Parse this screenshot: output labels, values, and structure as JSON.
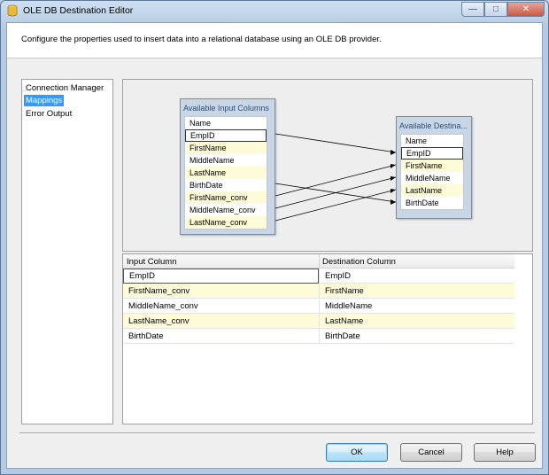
{
  "window": {
    "title": "OLE DB Destination Editor",
    "buttons": {
      "minimize_icon": "minimize-icon",
      "maximize_icon": "maximize-icon",
      "close_icon": "close-icon"
    }
  },
  "banner": {
    "description": "Configure the properties used to insert data into a relational database using an OLE DB provider."
  },
  "nav": {
    "items": [
      {
        "label": "Connection Manager",
        "selected": false
      },
      {
        "label": "Mappings",
        "selected": true
      },
      {
        "label": "Error Output",
        "selected": false
      }
    ]
  },
  "mapping": {
    "input_box": {
      "title": "Available Input Columns",
      "header": "Name",
      "columns": [
        "EmpID",
        "FirstName",
        "MiddleName",
        "LastName",
        "BirthDate",
        "FirstName_conv",
        "MiddleName_conv",
        "LastName_conv"
      ]
    },
    "dest_box": {
      "title": "Available Destina...",
      "header": "Name",
      "columns": [
        "EmpID",
        "FirstName",
        "MiddleName",
        "LastName",
        "BirthDate"
      ]
    }
  },
  "grid": {
    "headers": {
      "input": "Input Column",
      "destination": "Destination Column"
    },
    "rows": [
      {
        "input": "EmpID",
        "destination": "EmpID"
      },
      {
        "input": "FirstName_conv",
        "destination": "FirstName"
      },
      {
        "input": "MiddleName_conv",
        "destination": "MiddleName"
      },
      {
        "input": "LastName_conv",
        "destination": "LastName"
      },
      {
        "input": "BirthDate",
        "destination": "BirthDate"
      }
    ]
  },
  "footer": {
    "ok": "OK",
    "cancel": "Cancel",
    "help": "Help"
  },
  "colors": {
    "accent_selected": "#3399ff",
    "alt_row": "#fefbd8",
    "box_fill": "#c8d6e6"
  }
}
